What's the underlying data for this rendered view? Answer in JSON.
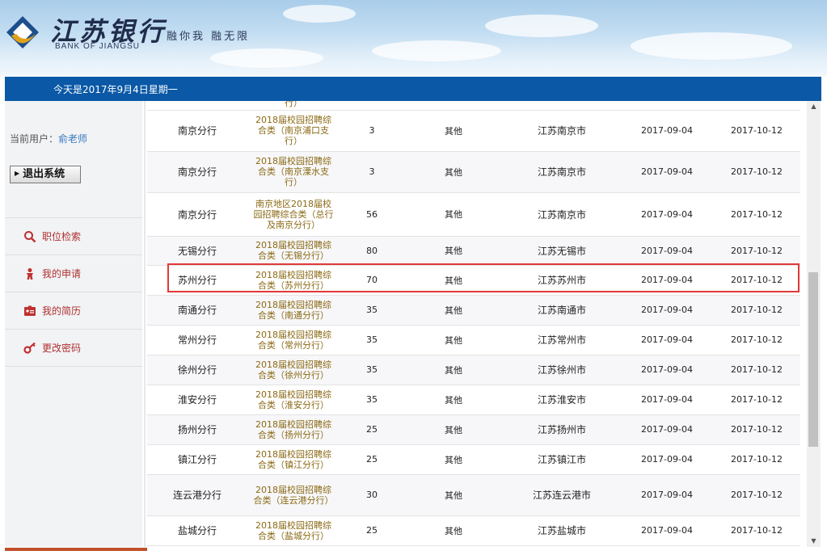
{
  "brand": {
    "name_cn": "江苏银行",
    "name_en": "BANK OF JIANGSU",
    "slogan": "融你我 融无限"
  },
  "date_text": "今天是2017年9月4日星期一",
  "user": {
    "label": "当前用户：",
    "name": "俞老师"
  },
  "logout_label": "退出系统",
  "menu": [
    {
      "label": "职位检索",
      "icon": "search-icon"
    },
    {
      "label": "我的申请",
      "icon": "person-icon"
    },
    {
      "label": "我的简历",
      "icon": "resume-icon"
    },
    {
      "label": "更改密码",
      "icon": "key-icon"
    }
  ],
  "partial_row": {
    "cat": "行）"
  },
  "rows": [
    {
      "branch": "南京分行",
      "cat": "2018届校园招聘综合类（南京浦口支行）",
      "count": "3",
      "type": "其他",
      "city": "江苏南京市",
      "start": "2017-09-04",
      "end": "2017-10-12"
    },
    {
      "branch": "南京分行",
      "cat": "2018届校园招聘综合类（南京溧水支行）",
      "count": "3",
      "type": "其他",
      "city": "江苏南京市",
      "start": "2017-09-04",
      "end": "2017-10-12"
    },
    {
      "branch": "南京分行",
      "cat": "南京地区2018届校园招聘综合类（总行及南京分行）",
      "count": "56",
      "type": "其他",
      "city": "江苏南京市",
      "start": "2017-09-04",
      "end": "2017-10-12"
    },
    {
      "branch": "无锡分行",
      "cat": "2018届校园招聘综合类（无锡分行）",
      "count": "80",
      "type": "其他",
      "city": "江苏无锡市",
      "start": "2017-09-04",
      "end": "2017-10-12"
    },
    {
      "branch": "苏州分行",
      "cat": "2018届校园招聘综合类（苏州分行）",
      "count": "70",
      "type": "其他",
      "city": "江苏苏州市",
      "start": "2017-09-04",
      "end": "2017-10-12"
    },
    {
      "branch": "南通分行",
      "cat": "2018届校园招聘综合类（南通分行）",
      "count": "35",
      "type": "其他",
      "city": "江苏南通市",
      "start": "2017-09-04",
      "end": "2017-10-12"
    },
    {
      "branch": "常州分行",
      "cat": "2018届校园招聘综合类（常州分行）",
      "count": "35",
      "type": "其他",
      "city": "江苏常州市",
      "start": "2017-09-04",
      "end": "2017-10-12"
    },
    {
      "branch": "徐州分行",
      "cat": "2018届校园招聘综合类（徐州分行）",
      "count": "35",
      "type": "其他",
      "city": "江苏徐州市",
      "start": "2017-09-04",
      "end": "2017-10-12"
    },
    {
      "branch": "淮安分行",
      "cat": "2018届校园招聘综合类（淮安分行）",
      "count": "35",
      "type": "其他",
      "city": "江苏淮安市",
      "start": "2017-09-04",
      "end": "2017-10-12"
    },
    {
      "branch": "扬州分行",
      "cat": "2018届校园招聘综合类（扬州分行）",
      "count": "25",
      "type": "其他",
      "city": "江苏扬州市",
      "start": "2017-09-04",
      "end": "2017-10-12"
    },
    {
      "branch": "镇江分行",
      "cat": "2018届校园招聘综合类（镇江分行）",
      "count": "25",
      "type": "其他",
      "city": "江苏镇江市",
      "start": "2017-09-04",
      "end": "2017-10-12"
    },
    {
      "branch": "连云港分行",
      "cat": "2018届校园招聘综合类（连云港分行）",
      "count": "30",
      "type": "其他",
      "city": "江苏连云港市",
      "start": "2017-09-04",
      "end": "2017-10-12"
    },
    {
      "branch": "盐城分行",
      "cat": "2018届校园招聘综合类（盐城分行）",
      "count": "25",
      "type": "其他",
      "city": "江苏盐城市",
      "start": "2017-09-04",
      "end": "2017-10-12"
    }
  ],
  "colors": {
    "date_bar": "#0a58a6",
    "category_text": "#8b6914",
    "menu_text": "#b03030",
    "highlight": "#e23838"
  }
}
